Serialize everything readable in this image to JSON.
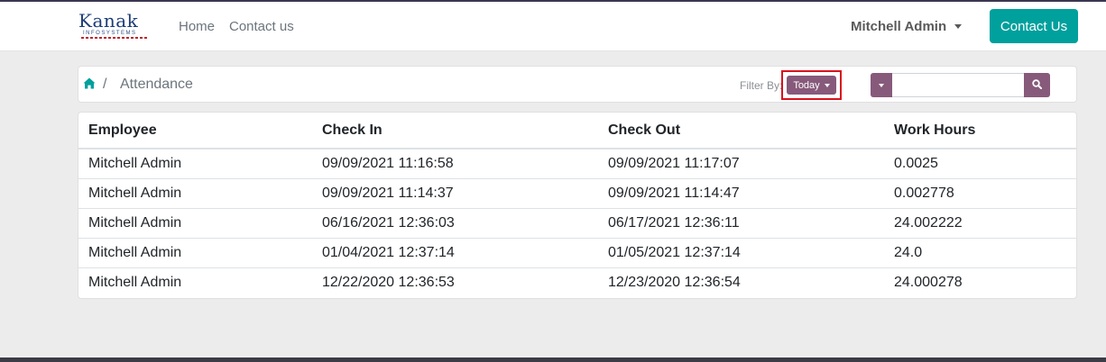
{
  "brand": {
    "logo_text": "Kanak",
    "logo_subtext": "INFOSYSTEMS"
  },
  "nav": {
    "links": [
      {
        "label": "Home"
      },
      {
        "label": "Contact us"
      }
    ],
    "user_name": "Mitchell Admin",
    "contact_button": "Contact Us"
  },
  "breadcrumb": {
    "separator": "/",
    "current": "Attendance"
  },
  "filter": {
    "label": "Filter By:",
    "selected": "Today"
  },
  "search": {
    "value": "",
    "placeholder": ""
  },
  "table": {
    "headers": [
      "Employee",
      "Check In",
      "Check Out",
      "Work Hours"
    ],
    "rows": [
      [
        "Mitchell Admin",
        "09/09/2021 11:16:58",
        "09/09/2021 11:17:07",
        "0.0025"
      ],
      [
        "Mitchell Admin",
        "09/09/2021 11:14:37",
        "09/09/2021 11:14:47",
        "0.002778"
      ],
      [
        "Mitchell Admin",
        "06/16/2021 12:36:03",
        "06/17/2021 12:36:11",
        "24.002222"
      ],
      [
        "Mitchell Admin",
        "01/04/2021 12:37:14",
        "01/05/2021 12:37:14",
        "24.0"
      ],
      [
        "Mitchell Admin",
        "12/22/2020 12:36:53",
        "12/23/2020 12:36:54",
        "24.000278"
      ]
    ]
  },
  "colors": {
    "accent": "#00a09d",
    "primary": "#875a7b",
    "highlight_border": "#d9121c"
  },
  "icons": {
    "home": "home-icon",
    "search": "search-icon",
    "dropdown": "caret-down-icon"
  }
}
